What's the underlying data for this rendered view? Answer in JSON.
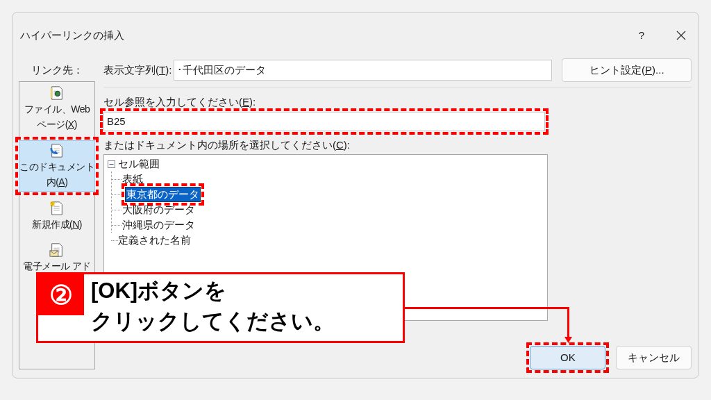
{
  "window": {
    "title": "ハイパーリンクの挿入",
    "help": "?"
  },
  "sidebar": {
    "label": "リンク先：",
    "items": [
      {
        "kind": "file",
        "lines": [
          {
            "text": "ファイル、Web"
          },
          {
            "before": "ページ(",
            "key": "X",
            "after": ")"
          }
        ],
        "selected": false,
        "highlighted": false
      },
      {
        "kind": "document",
        "lines": [
          {
            "text": "このドキュメント"
          },
          {
            "before": "内(",
            "key": "A",
            "after": ")"
          }
        ],
        "selected": true,
        "highlighted": true
      },
      {
        "kind": "new",
        "lines": [
          {
            "before": "新規作成(",
            "key": "N",
            "after": ")"
          }
        ],
        "selected": false,
        "highlighted": false
      },
      {
        "kind": "email",
        "lines": [
          {
            "text": "電子メール アド"
          }
        ],
        "selected": false,
        "highlighted": false
      }
    ]
  },
  "display_text": {
    "label": {
      "before": "表示文字列(",
      "key": "T",
      "after": "):"
    },
    "value": "･千代田区のデータ"
  },
  "hint_button": {
    "before": "ヒント設定(",
    "key": "P",
    "after": ")..."
  },
  "cell_reference": {
    "label": {
      "before": "セル参照を入力してください(",
      "key": "E",
      "after": "):"
    },
    "value": "B25",
    "highlighted": true
  },
  "place": {
    "label": {
      "before": "またはドキュメント内の場所を選択してください(",
      "key": "C",
      "after": "):"
    },
    "tree": [
      {
        "label": "セル範囲",
        "expanded": true,
        "children": [
          {
            "label": "表紙",
            "selected": false,
            "highlighted": false
          },
          {
            "label": "東京都のデータ",
            "selected": true,
            "highlighted": true
          },
          {
            "label": "大阪府のデータ",
            "selected": false,
            "highlighted": false
          },
          {
            "label": "沖縄県のデータ",
            "selected": false,
            "highlighted": false
          }
        ]
      },
      {
        "label": "定義された名前"
      }
    ]
  },
  "buttons": [
    {
      "label": "OK",
      "kind": "default",
      "highlighted": true
    },
    {
      "label": "キャンセル",
      "kind": "normal",
      "highlighted": false
    }
  ],
  "callout": {
    "number": "②",
    "lines": [
      "[OK]ボタンを",
      "クリックしてください。"
    ]
  }
}
